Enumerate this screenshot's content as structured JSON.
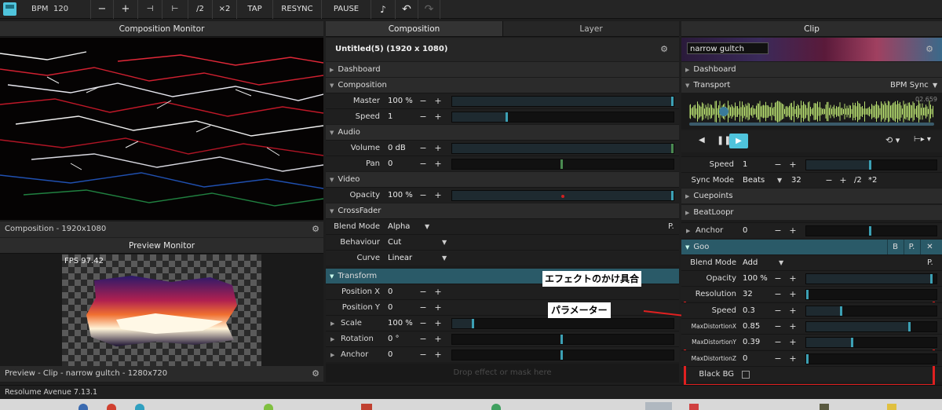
{
  "toolbar": {
    "bpm_label": "BPM",
    "bpm_value": "120",
    "minus": "−",
    "plus": "+",
    "nudge_left": "⊣",
    "nudge_right": "⊢",
    "div2": "/2",
    "mul2": "×2",
    "tap": "TAP",
    "resync": "RESYNC",
    "pause": "PAUSE",
    "metronome": "♪",
    "undo": "↶",
    "redo": "↷"
  },
  "comp_monitor": {
    "title": "Composition Monitor",
    "footer": "Composition - 1920x1080"
  },
  "preview_monitor": {
    "title": "Preview Monitor",
    "fps": "FPS 97.42",
    "footer": "Preview - Clip - narrow gultch - 1280x720"
  },
  "middle": {
    "tab_composition": "Composition",
    "tab_layer": "Layer",
    "comp_title": "Untitled(5) (1920 x 1080)",
    "drop_hint": "Drop effect or mask here",
    "sections": {
      "dashboard": "Dashboard",
      "composition": "Composition",
      "audio": "Audio",
      "video": "Video",
      "crossfader": "CrossFader",
      "transform": "Transform"
    },
    "params": {
      "master": {
        "label": "Master",
        "value": "100 %",
        "level": 1.0
      },
      "speed": {
        "label": "Speed",
        "value": "1",
        "level": 0.25
      },
      "volume": {
        "label": "Volume",
        "value": "0 dB",
        "level": 1.0
      },
      "pan": {
        "label": "Pan",
        "value": "0",
        "level": 0.5
      },
      "opacity": {
        "label": "Opacity",
        "value": "100 %",
        "level": 1.0
      },
      "blend": {
        "label": "Blend Mode",
        "value": "Alpha"
      },
      "behaviour": {
        "label": "Behaviour",
        "value": "Cut"
      },
      "curve": {
        "label": "Curve",
        "value": "Linear"
      },
      "posx": {
        "label": "Position X",
        "value": "0"
      },
      "posy": {
        "label": "Position Y",
        "value": "0"
      },
      "scale": {
        "label": "Scale",
        "value": "100 %",
        "level": 0.1
      },
      "rotation": {
        "label": "Rotation",
        "value": "0 °",
        "level": 0.5
      },
      "anchor": {
        "label": "Anchor",
        "value": "0",
        "level": 0.5
      }
    }
  },
  "clip": {
    "title": "Clip",
    "clip_name": "narrow gultch",
    "dashboard": "Dashboard",
    "transport": "Transport",
    "bpm_sync": "BPM Sync",
    "wave_time": "02.659",
    "speed": {
      "label": "Speed",
      "value": "1",
      "level": 0.5
    },
    "sync": {
      "label": "Sync Mode",
      "value": "Beats",
      "beats": "32",
      "div2": "/2",
      "mul2": "*2"
    },
    "cuepoints": "Cuepoints",
    "beatloopr": "BeatLoopr",
    "anchor": {
      "label": "Anchor",
      "value": "0",
      "level": 0.5
    },
    "goo": {
      "title": "Goo",
      "btn_b": "B",
      "btn_p": "P.",
      "btn_x": "✕",
      "blend_label": "Blend Mode",
      "blend_value": "Add",
      "params": [
        {
          "label": "Opacity",
          "value": "100 %",
          "level": 0.97
        },
        {
          "label": "Resolution",
          "value": "32",
          "level": 0.0
        },
        {
          "label": "Speed",
          "value": "0.3",
          "level": 0.28
        },
        {
          "label": "MaxDistortionX",
          "value": "0.85",
          "level": 0.8
        },
        {
          "label": "MaxDistortionY",
          "value": "0.39",
          "level": 0.36
        },
        {
          "label": "MaxDistortionZ",
          "value": "0",
          "level": 0.0
        }
      ],
      "blackbg_label": "Black BG"
    }
  },
  "annotations": {
    "effect_amount": "エフェクトのかけ具合",
    "parameters": "パラメーター"
  },
  "status": {
    "text": "Resolume Avenue 7.13.1"
  },
  "colors": {
    "accent": "#4fc4dc",
    "highlight": "#2a5a68",
    "annotation_yellow": "#f0e020",
    "annotation_red": "#e02020",
    "waveform": "#b8e070"
  }
}
